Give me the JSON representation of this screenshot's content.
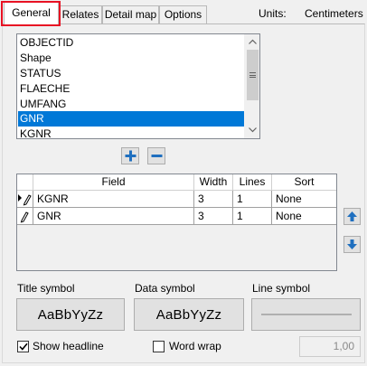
{
  "tabs": [
    {
      "label": "General",
      "active": true
    },
    {
      "label": "Relates",
      "active": false
    },
    {
      "label": "Detail map",
      "active": false
    },
    {
      "label": "Options",
      "active": false
    }
  ],
  "units": {
    "label": "Units:",
    "value": "Centimeters"
  },
  "field_list": {
    "items": [
      "OBJECTID",
      "Shape",
      "STATUS",
      "FLAECHE",
      "UMFANG",
      "GNR",
      "KGNR"
    ],
    "selected": "GNR"
  },
  "grid": {
    "columns": [
      "Field",
      "Width",
      "Lines",
      "Sort"
    ],
    "rows": [
      {
        "field": "KGNR",
        "width": "3",
        "lines": "1",
        "sort": "None",
        "current": true
      },
      {
        "field": "GNR",
        "width": "3",
        "lines": "1",
        "sort": "None",
        "current": false
      }
    ]
  },
  "symbols": {
    "title_label": "Title symbol",
    "title_sample": "AaBbYyZz",
    "data_label": "Data symbol",
    "data_sample": "AaBbYyZz",
    "line_label": "Line symbol"
  },
  "options": {
    "show_headline_label": "Show headline",
    "show_headline_checked": true,
    "word_wrap_label": "Word wrap",
    "word_wrap_checked": false,
    "wrap_value": "1,00"
  },
  "colors": {
    "selection": "#0078d7",
    "highlight_box": "#e81123",
    "arrow_blue": "#1f6fbf"
  }
}
